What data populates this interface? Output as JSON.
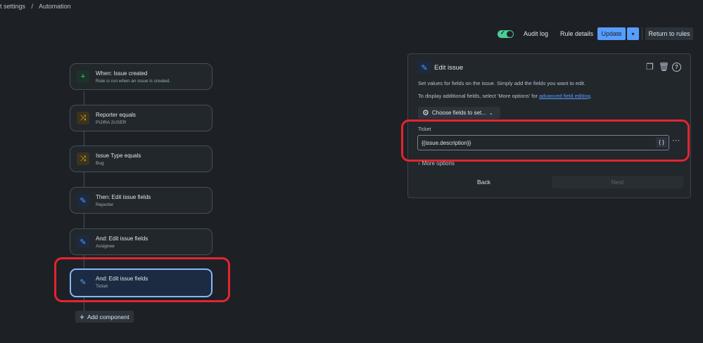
{
  "breadcrumb": [
    "t settings",
    "/",
    "Automation"
  ],
  "toolbar": {
    "audit_log": "Audit log",
    "rule_details": "Rule details",
    "update": "Update",
    "update_caret": "▾",
    "return": "Return to rules",
    "rule_enabled": true
  },
  "flow": {
    "nodes": [
      {
        "icon": "plus-icon",
        "glyph": "+",
        "title": "When: Issue created",
        "subtitle": "Rule is run when an issue is created."
      },
      {
        "icon": "condition-icon",
        "glyph": "⤨",
        "title": "Reporter equals",
        "subtitle": "PIJIRA 2USER"
      },
      {
        "icon": "condition-icon",
        "glyph": "⤨",
        "title": "Issue Type equals",
        "subtitle": "Bug"
      },
      {
        "icon": "pencil-icon",
        "glyph": "✎",
        "title": "Then: Edit issue fields",
        "subtitle": "Reporter"
      },
      {
        "icon": "pencil-icon",
        "glyph": "✎",
        "title": "And: Edit issue fields",
        "subtitle": "Assignee"
      },
      {
        "icon": "pencil-icon",
        "glyph": "✎",
        "title": "And: Edit issue fields",
        "subtitle": "Ticket"
      }
    ],
    "add_component": "Add component"
  },
  "panel": {
    "title": "Edit issue",
    "description": "Set values for fields on the issue. Simply add the fields you want to edit.",
    "additional_prefix": "To display additional fields, select 'More options' for ",
    "additional_link": "advanced field editing",
    "additional_suffix": ".",
    "choose_fields": "Choose fields to set...",
    "field_label": "Ticket",
    "field_value": "{{issue.description}}",
    "braces": "{ }",
    "more_options": "More options",
    "back": "Back",
    "next": "Next"
  },
  "colors": {
    "background": "#1d2125",
    "accent": "#579dff",
    "highlight": "#e5242f",
    "toggle_on": "#4bce97"
  }
}
